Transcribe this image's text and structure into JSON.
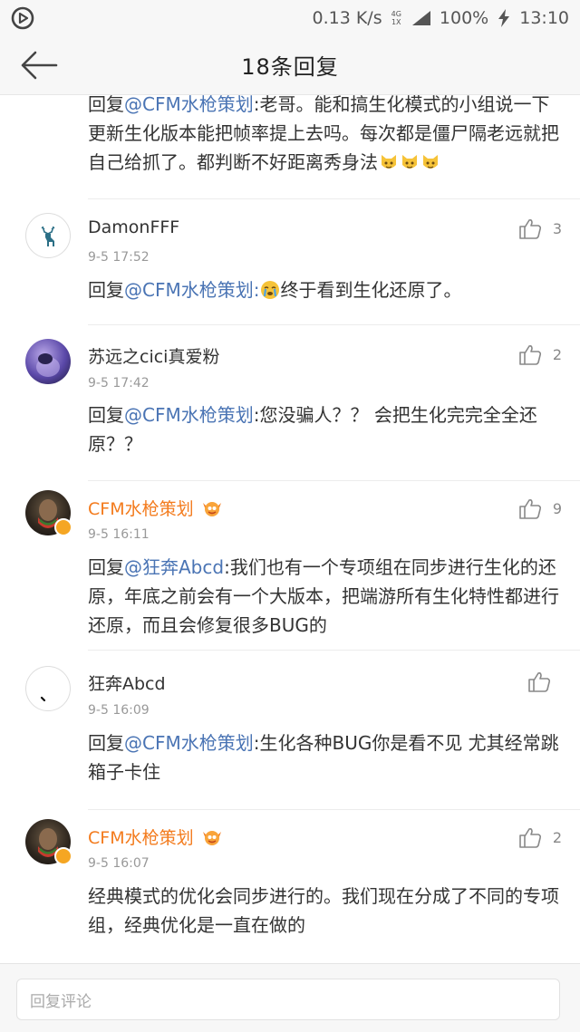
{
  "status_bar": {
    "network_speed": "0.13 K/s",
    "network_type_top": "4G",
    "network_type_bottom": "1X",
    "battery": "100%",
    "time": "13:10"
  },
  "header": {
    "title": "18条回复",
    "back_icon": "arrow-left-icon"
  },
  "comments": [
    {
      "text_prefix": "回复",
      "mention": "@CFM水枪策划",
      "text": ":老哥。能和搞生化模式的小组说一下更新生化版本能把帧率提上去吗。每次都是僵尸隔老远就把自己给抓了。都判断不好距离秀身法",
      "emoji": "cat-face-emoji"
    },
    {
      "name": "DamonFFF",
      "time": "9-5 17:52",
      "likes": "3",
      "text_prefix": "回复",
      "mention": "@CFM水枪策划",
      "text": "终于看到生化还原了。",
      "emoji": "crying-face-emoji"
    },
    {
      "name": "苏远之cici真爱粉",
      "time": "9-5 17:42",
      "likes": "2",
      "text_prefix": "回复",
      "mention": "@CFM水枪策划",
      "text": ":您没骗人？？ 会把生化完完全全还原？？"
    },
    {
      "name": "CFM水枪策划",
      "time": "9-5 16:11",
      "likes": "9",
      "official": true,
      "text_prefix": "回复",
      "mention": "@狂奔Abcd",
      "text": ":我们也有一个专项组在同步进行生化的还原，年底之前会有一个大版本，把端游所有生化特性都进行还原，而且会修复很多BUG的"
    },
    {
      "name": "狂奔Abcd",
      "time": "9-5 16:09",
      "likes": "",
      "text_prefix": "回复",
      "mention": "@CFM水枪策划",
      "text": ":生化各种BUG你是看不见 尤其经常跳箱子卡住"
    },
    {
      "name": "CFM水枪策划",
      "time": "9-5 16:07",
      "likes": "2",
      "official": true,
      "text": "经典模式的优化会同步进行的。我们现在分成了不同的专项组，经典优化是一直在做的"
    }
  ],
  "footer": {
    "reply_placeholder": "回复评论"
  },
  "colors": {
    "mention": "#4a74b4",
    "official_name": "#f37b1d",
    "time": "#999999"
  }
}
